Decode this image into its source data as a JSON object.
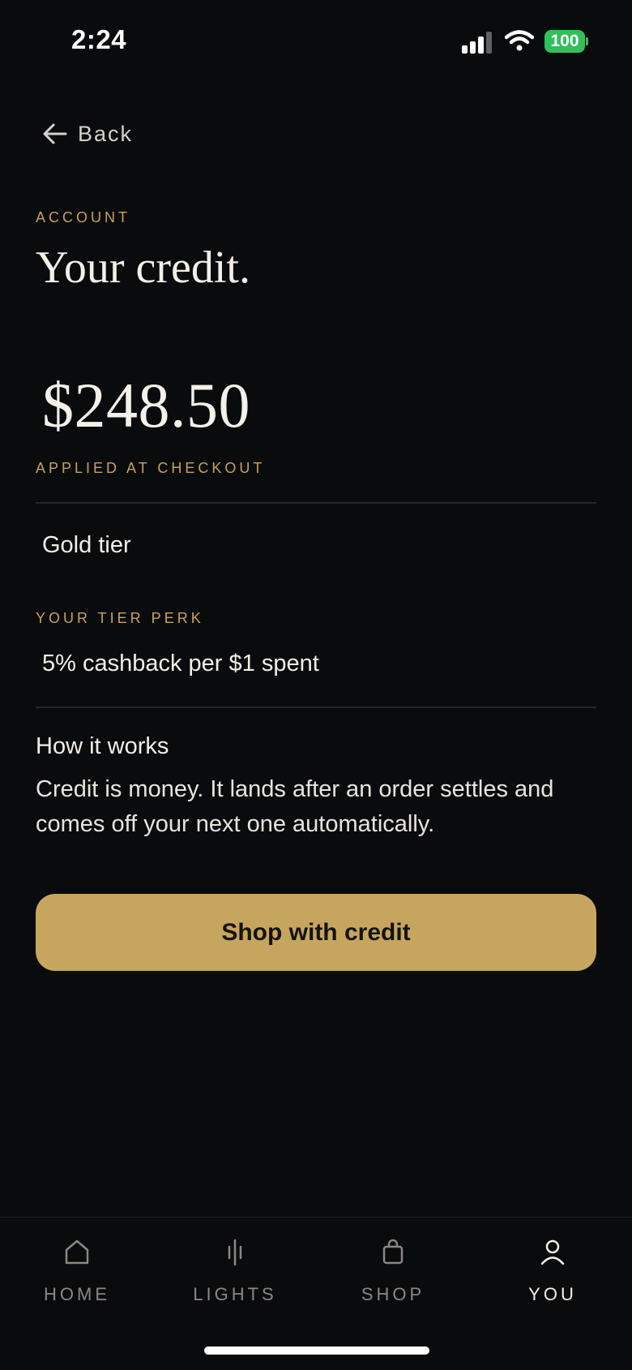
{
  "status": {
    "time": "2:24",
    "battery": "100"
  },
  "nav": {
    "back_label": "Back"
  },
  "header": {
    "eyebrow": "ACCOUNT",
    "title": "Your credit."
  },
  "credit": {
    "amount": "$248.50",
    "amount_note": "APPLIED AT CHECKOUT",
    "tier": "Gold tier",
    "perk_label": "YOUR TIER PERK",
    "perk": "5% cashback per $1 spent"
  },
  "how": {
    "heading": "How it works",
    "body": "Credit is money. It lands after an order settles and comes off your next one automatically."
  },
  "cta": {
    "label": "Shop with credit"
  },
  "tabs": [
    {
      "label": "HOME",
      "icon": "home-icon",
      "active": false
    },
    {
      "label": "LIGHTS",
      "icon": "lights-icon",
      "active": false
    },
    {
      "label": "SHOP",
      "icon": "shopping-bag-icon",
      "active": false
    },
    {
      "label": "YOU",
      "icon": "user-icon",
      "active": true
    }
  ],
  "colors": {
    "accent": "#c6a65f",
    "background": "#0a0b0d",
    "battery": "#31c05a"
  }
}
